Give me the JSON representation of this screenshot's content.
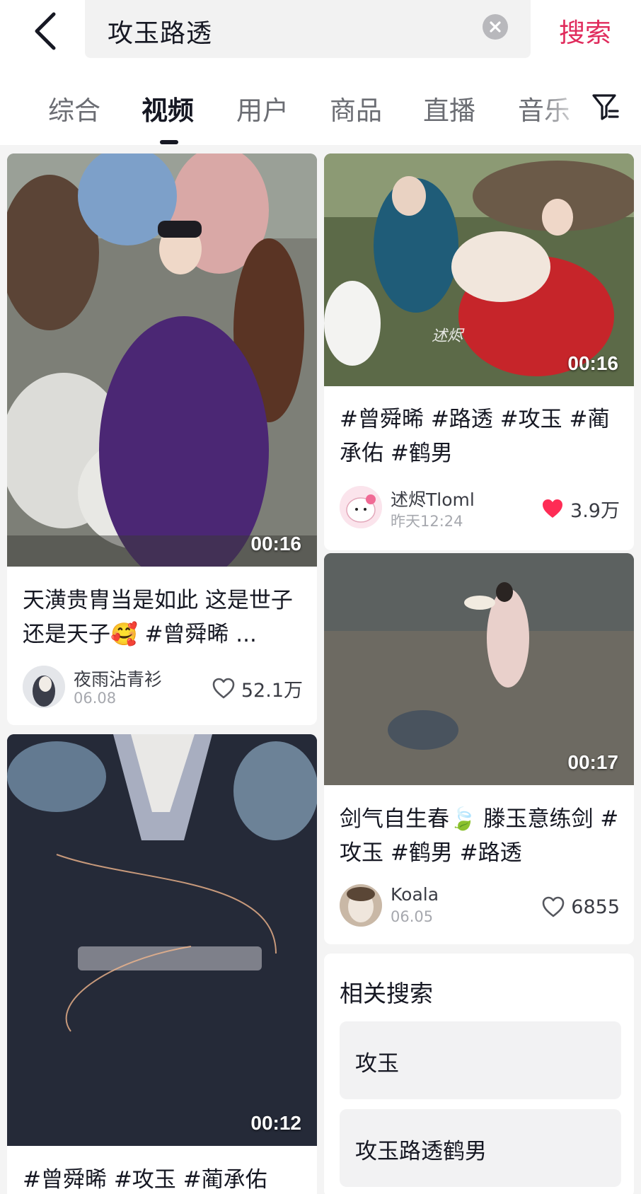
{
  "search": {
    "query": "攻玉路透",
    "submit_label": "搜索"
  },
  "tabs": [
    {
      "label": "综合",
      "active": false
    },
    {
      "label": "视频",
      "active": true
    },
    {
      "label": "用户",
      "active": false
    },
    {
      "label": "商品",
      "active": false
    },
    {
      "label": "直播",
      "active": false
    },
    {
      "label": "音乐",
      "active": false
    }
  ],
  "cards": [
    {
      "duration": "00:16",
      "title": "天潢贵胄当是如此 这是世子还是天子🥰 #曾舜晞 ...",
      "author": "夜雨沾青衫",
      "date": "06.08",
      "likes": "52.1万",
      "liked": false
    },
    {
      "duration": "00:16",
      "title": "#曾舜晞 #路透 #攻玉 #蔺承佑 #鹤男",
      "author": "述烬Tloml",
      "date": "昨天12:24",
      "likes": "3.9万",
      "liked": true,
      "watermark": "述烬"
    },
    {
      "duration": "00:17",
      "title": "剑气自生春🍃 滕玉意练剑 #攻玉 #鹤男 #路透",
      "author": "Koala",
      "date": "06.05",
      "likes": "6855",
      "liked": false
    },
    {
      "duration": "00:12",
      "title": "#曾舜晞 #攻玉 #蔺承佑"
    }
  ],
  "related": {
    "title": "相关搜索",
    "items": [
      "攻玉",
      "攻玉路透鹤男"
    ]
  },
  "colors": {
    "accent": "#e02b5c",
    "like_red": "#fe2c55",
    "text": "#161823",
    "muted": "#a6a8ae"
  }
}
